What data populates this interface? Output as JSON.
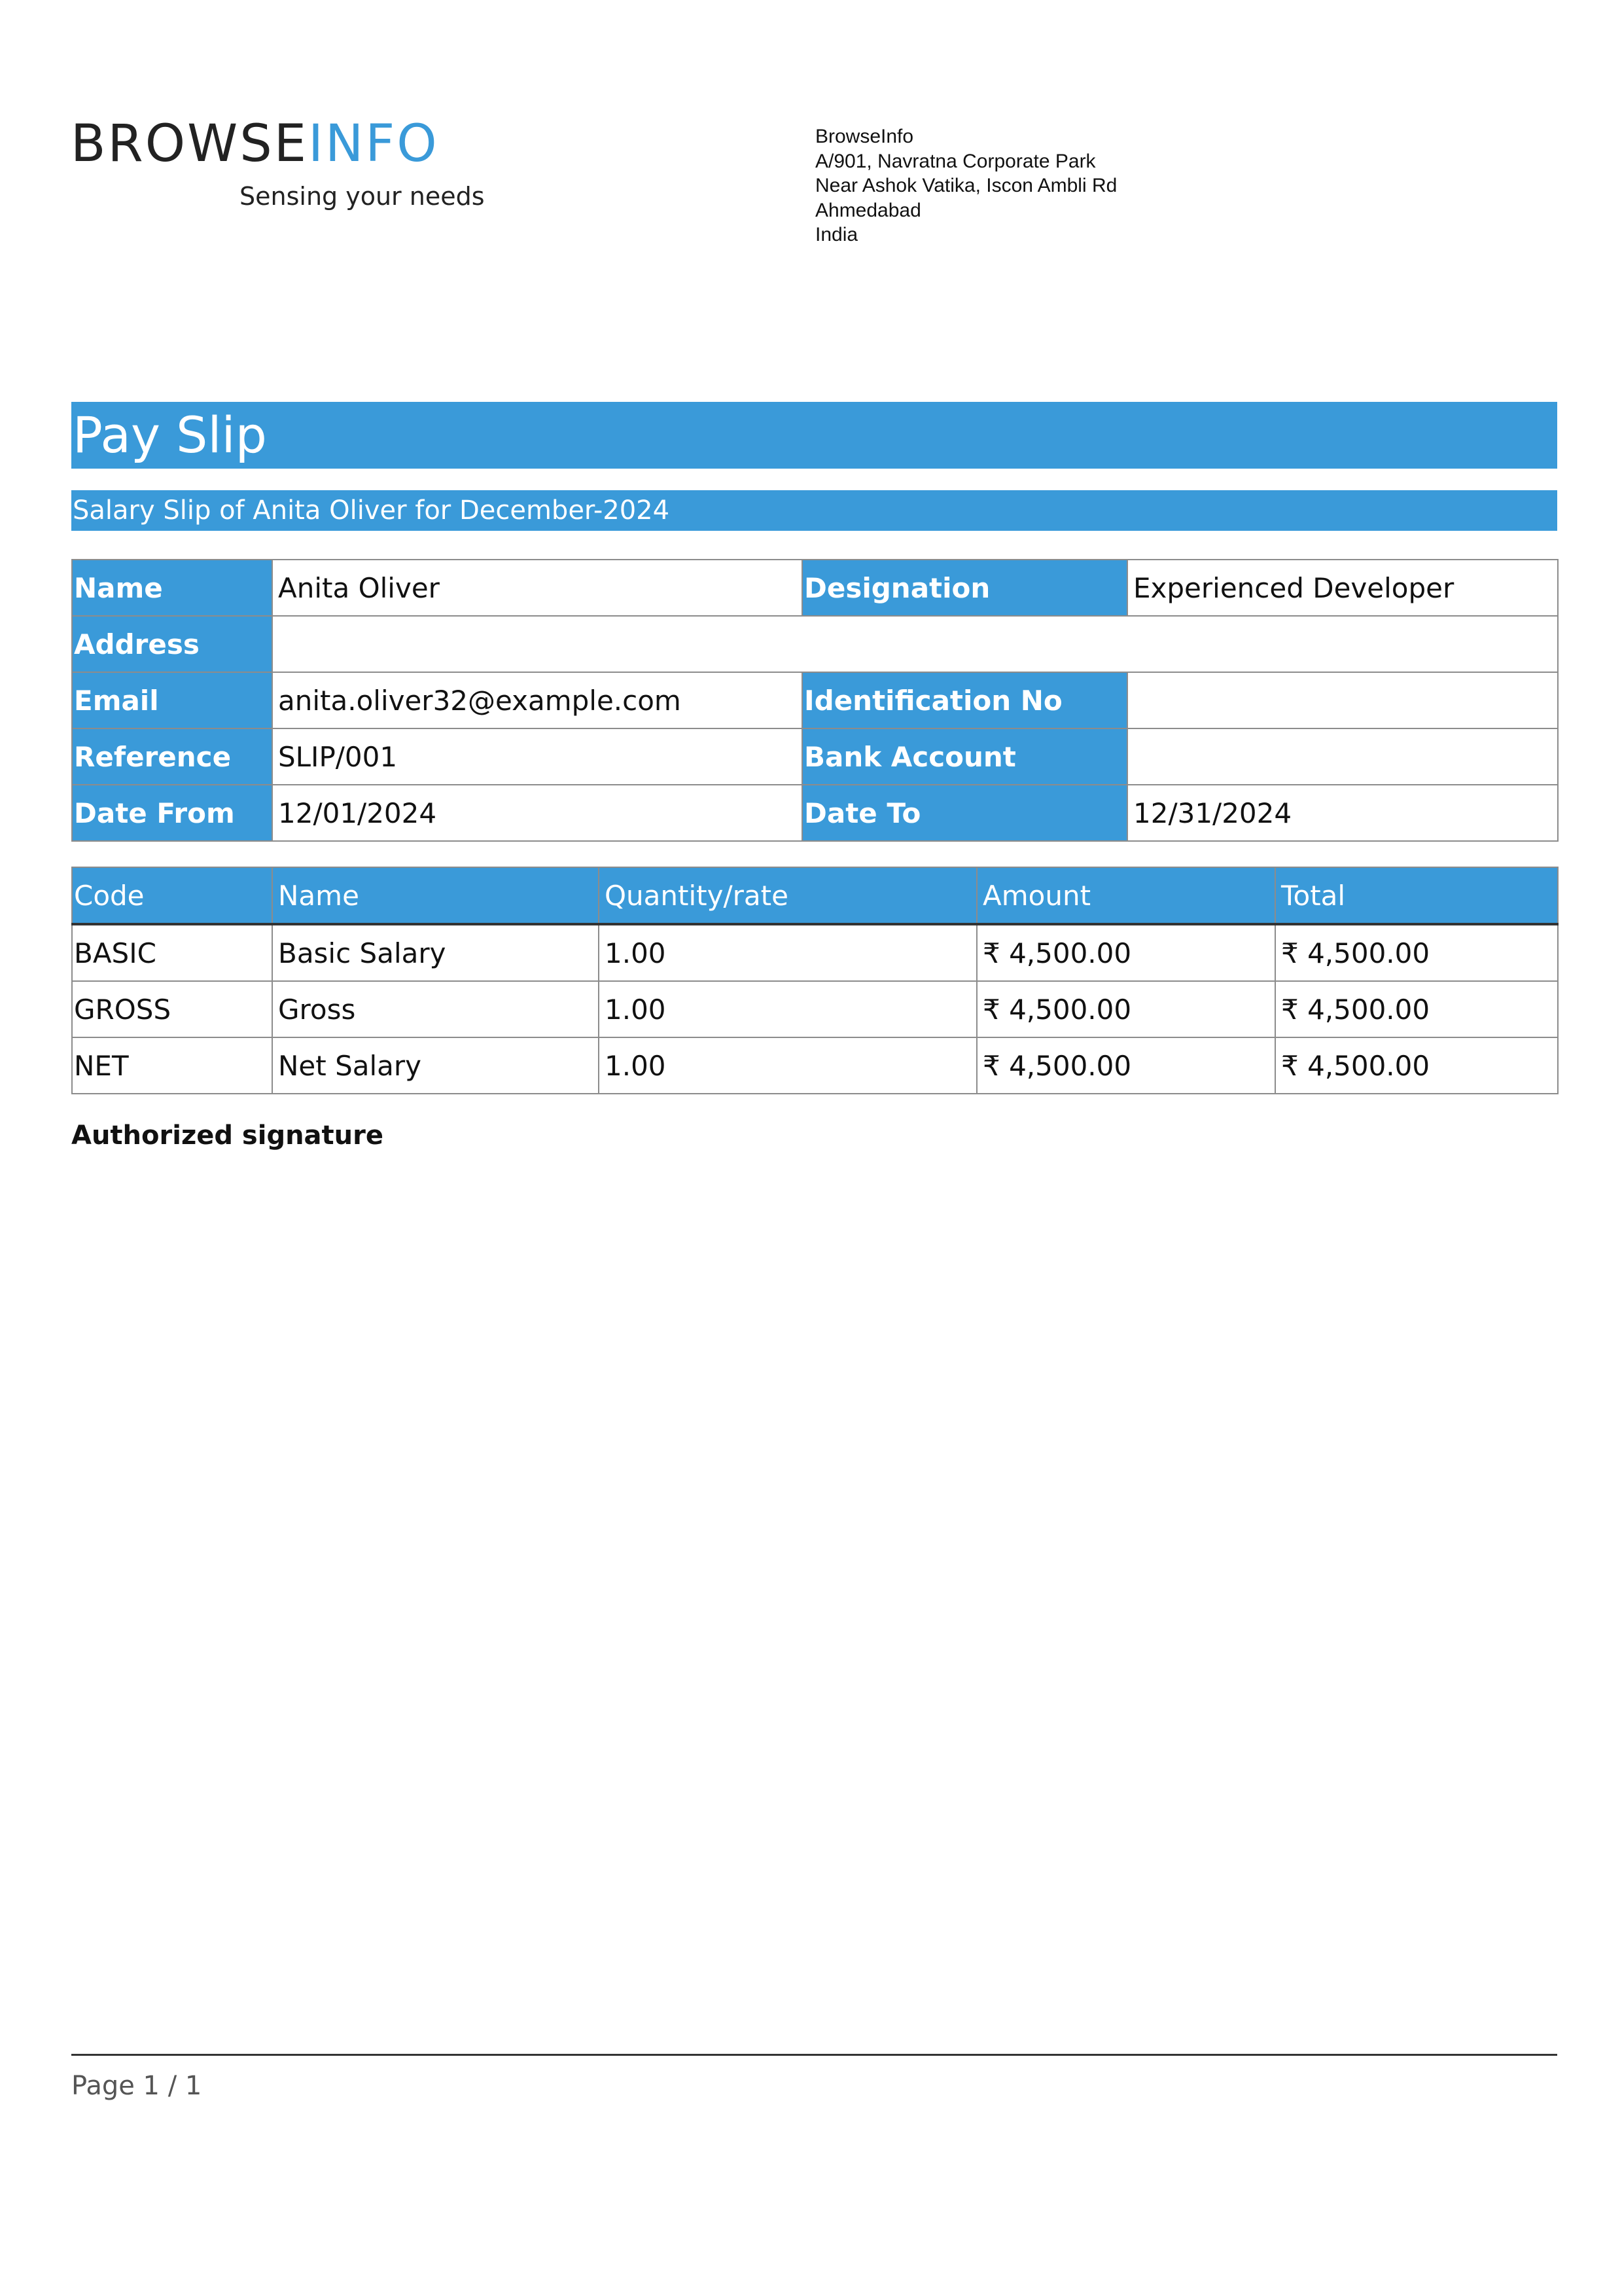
{
  "logo": {
    "word_dark": "BROWSE",
    "word_blue": "INFO",
    "tagline": "Sensing your needs"
  },
  "company": {
    "name": "BrowseInfo",
    "address_line1": "A/901, Navratna Corporate Park",
    "address_line2": "Near Ashok Vatika, Iscon Ambli Rd",
    "city": "Ahmedabad",
    "country": "India"
  },
  "title": "Pay Slip",
  "subtitle": "Salary Slip of Anita Oliver for December-2024",
  "info": {
    "name_label": "Name",
    "name_value": "Anita Oliver",
    "designation_label": "Designation",
    "designation_value": "Experienced Developer",
    "address_label": "Address",
    "address_value": "",
    "email_label": "Email",
    "email_value": "anita.oliver32@example.com",
    "identification_label": "Identification No",
    "identification_value": "",
    "reference_label": "Reference",
    "reference_value": "SLIP/001",
    "bank_label": "Bank Account",
    "bank_value": "",
    "date_from_label": "Date From",
    "date_from_value": "12/01/2024",
    "date_to_label": "Date To",
    "date_to_value": "12/31/2024"
  },
  "lines": {
    "headers": [
      "Code",
      "Name",
      "Quantity/rate",
      "Amount",
      "Total"
    ],
    "rows": [
      {
        "code": "BASIC",
        "name": "Basic Salary",
        "qty": "1.00",
        "amount": "₹ 4,500.00",
        "total": "₹ 4,500.00"
      },
      {
        "code": "GROSS",
        "name": "Gross",
        "qty": "1.00",
        "amount": "₹ 4,500.00",
        "total": "₹ 4,500.00"
      },
      {
        "code": "NET",
        "name": "Net Salary",
        "qty": "1.00",
        "amount": "₹ 4,500.00",
        "total": "₹ 4,500.00"
      }
    ]
  },
  "signature": "Authorized signature",
  "footer": {
    "page": "Page 1 / 1"
  },
  "colors": {
    "accent": "#3a9ad9",
    "text": "#222222"
  }
}
